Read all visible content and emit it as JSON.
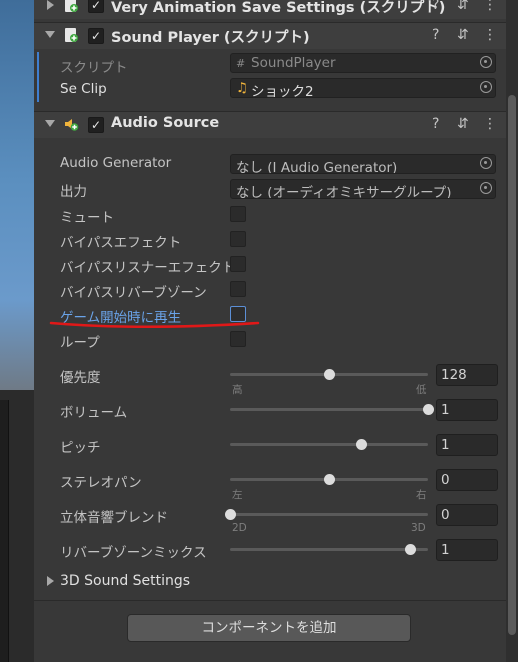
{
  "components": {
    "very_animation": {
      "title": "Very Animation Save Settings (スクリプト)",
      "enabled": "✓"
    },
    "sound_player": {
      "title": "Sound Player (スクリプト)",
      "enabled": "✓",
      "script_label": "スクリプト",
      "script_value": "SoundPlayer",
      "se_clip_label": "Se Clip",
      "se_clip_value": "ショック2"
    },
    "audio_source": {
      "title": "Audio Source",
      "enabled": "✓"
    }
  },
  "icons": {
    "help": "?",
    "preset": "⇵",
    "menu": "⋮",
    "script_glyph": "#",
    "note": "♫"
  },
  "audio_source": {
    "generator_label": "Audio Generator",
    "generator_value": "なし (I Audio Generator)",
    "output_label": "出力",
    "output_value": "なし (オーディオミキサーグループ)",
    "mute_label": "ミュート",
    "bypass_effects_label": "バイパスエフェクト",
    "bypass_listener_label": "バイパスリスナーエフェクト",
    "bypass_reverb_label": "バイパスリバーブゾーン",
    "play_on_awake_label": "ゲーム開始時に再生",
    "loop_label": "ループ",
    "priority": {
      "label": "優先度",
      "value": "128",
      "min_label": "高",
      "max_label": "低",
      "fraction": 0.5
    },
    "volume": {
      "label": "ボリューム",
      "value": "1",
      "fraction": 1.0
    },
    "pitch": {
      "label": "ピッチ",
      "value": "1",
      "fraction": 0.66
    },
    "stereo_pan": {
      "label": "ステレオパン",
      "value": "0",
      "min_label": "左",
      "max_label": "右",
      "fraction": 0.5
    },
    "spatial_blend": {
      "label": "立体音響ブレンド",
      "value": "0",
      "min_label": "2D",
      "max_label": "3D",
      "fraction": 0.0
    },
    "reverb_mix": {
      "label": "リバーブゾーンミックス",
      "value": "1",
      "fraction": 0.91
    },
    "sound_3d_label": "3D Sound Settings"
  },
  "add_component_label": "コンポーネントを追加",
  "colors": {
    "annotation_underline": "#e01818",
    "selection": "#3f7fd0",
    "highlight_text": "#6aa3e8"
  }
}
